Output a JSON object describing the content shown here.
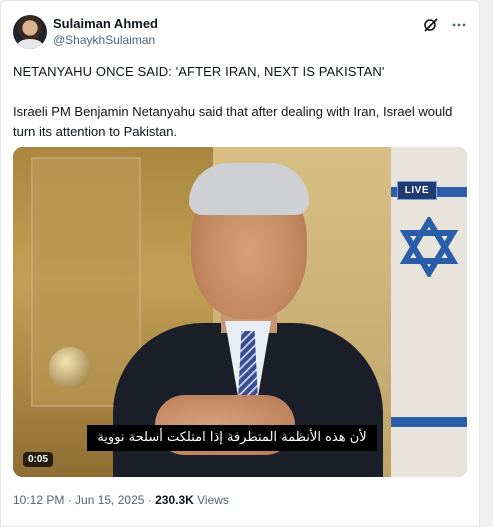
{
  "author": {
    "display_name": "Sulaiman Ahmed",
    "handle": "@ShaykhSulaiman",
    "avatar_icon": "profile-photo"
  },
  "actions": {
    "grok_icon": "grok-slash-icon",
    "more_icon": "more-horizontal-icon"
  },
  "post": {
    "headline": "NETANYAHU ONCE SAID: 'AFTER IRAN, NEXT IS PAKISTAN'",
    "body": "Israeli PM Benjamin Netanyahu said that after dealing with Iran, Israel would turn its attention to Pakistan."
  },
  "video": {
    "live_badge": "LIVE",
    "subtitle": "لأن هذه الأنظمة المتطرفة إذا امتلكت أسلحة نووية",
    "time": "0:05"
  },
  "meta": {
    "timestamp": "10:12 PM · Jun 15, 2025",
    "separator": " · ",
    "views_count": "230.3K",
    "views_label": " Views"
  },
  "colors": {
    "text_primary": "#0f1419",
    "text_secondary": "#536471",
    "live_badge_bg": "#1e3c72"
  }
}
